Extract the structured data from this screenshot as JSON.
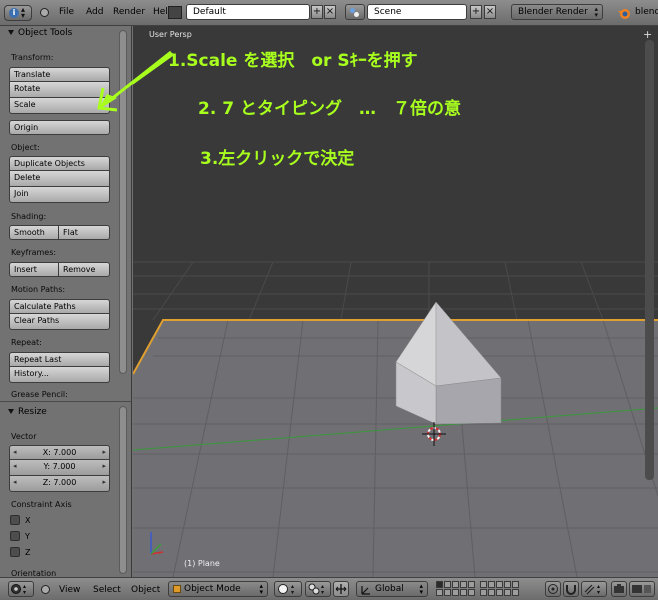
{
  "header": {
    "menus": [
      "File",
      "Add",
      "Render",
      "Help"
    ],
    "layout_value": "Default",
    "scene_value": "Scene",
    "render_engine": "Blender Render",
    "blend_text": "blend"
  },
  "tool_shelf": {
    "object_tools_title": "Object Tools",
    "transform_label": "Transform:",
    "translate": "Translate",
    "rotate": "Rotate",
    "scale": "Scale",
    "origin": "Origin",
    "object_label": "Object:",
    "duplicate_objects": "Duplicate Objects",
    "delete": "Delete",
    "join": "Join",
    "shading_label": "Shading:",
    "smooth": "Smooth",
    "flat": "Flat",
    "keyframes_label": "Keyframes:",
    "insert": "Insert",
    "remove": "Remove",
    "motion_paths_label": "Motion Paths:",
    "calculate_paths": "Calculate Paths",
    "clear_paths": "Clear Paths",
    "repeat_label": "Repeat:",
    "repeat_last": "Repeat Last",
    "history": "History...",
    "grease_pencil_label": "Grease Pencil:"
  },
  "resize_panel": {
    "title": "Resize",
    "vector_label": "Vector",
    "x": "X: 7.000",
    "y": "Y: 7.000",
    "z": "Z: 7.000",
    "constraint_axis_label": "Constraint Axis",
    "axis_x": "X",
    "axis_y": "Y",
    "axis_z": "Z",
    "orientation_label": "Orientation"
  },
  "viewport": {
    "view_name": "User Persp",
    "object_name": "(1) Plane"
  },
  "annotations": {
    "step1": "1.Scale を選択　or Sｷｰを押す",
    "step2": "2. 7 とタイピング　…　７倍の意",
    "step3": "3.左クリックで決定"
  },
  "footer": {
    "view": "View",
    "select": "Select",
    "object": "Object",
    "mode": "Object Mode",
    "orientation": "Global"
  },
  "colors": {
    "annotation": "#a8ff1e",
    "grid_edge": "#e0a030",
    "viewport_bg": "#393939"
  }
}
